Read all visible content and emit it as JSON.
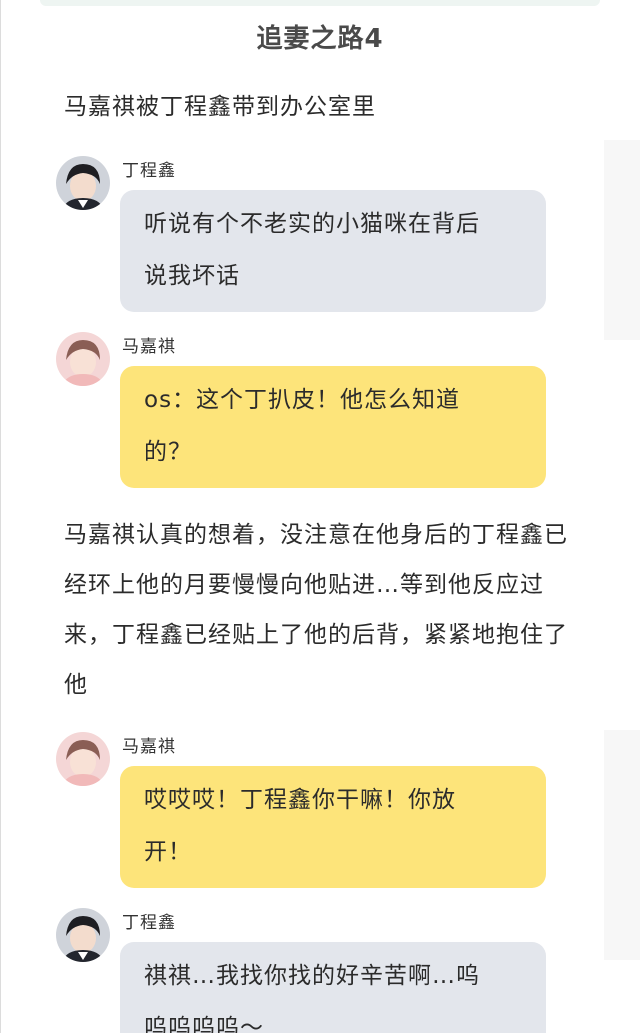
{
  "title": "追妻之路4",
  "narration_1": "马嘉祺被丁程鑫带到办公室里",
  "narration_2": "马嘉祺认真的想着，没注意在他身后的丁程鑫已经环上他的月要慢慢向他贴进…等到他反应过来，丁程鑫已经贴上了他的后背，紧紧地抱住了他",
  "messages": [
    {
      "speaker": "丁程鑫",
      "line1": "听说有个不老实的小猫咪在背后",
      "line2": "说我坏话",
      "style": "gray",
      "avatar": "boy-avatar-dark-hair"
    },
    {
      "speaker": "马嘉祺",
      "line1": "os：这个丁扒皮！他怎么知道",
      "line2": "的？",
      "style": "yellow",
      "avatar": "boy-avatar-pink"
    },
    {
      "speaker": "马嘉祺",
      "line1": "哎哎哎！丁程鑫你干嘛！你放",
      "line2": "开！",
      "style": "yellow",
      "avatar": "boy-avatar-pink"
    },
    {
      "speaker": "丁程鑫",
      "line1": "祺祺…我找你找的好辛苦啊…呜",
      "line2": "呜呜呜呜～",
      "style": "gray",
      "avatar": "boy-avatar-dark-hair"
    }
  ],
  "colors": {
    "gray_bubble": "#e3e6ec",
    "yellow_bubble": "#fde47a",
    "title": "#4a4a4a"
  }
}
